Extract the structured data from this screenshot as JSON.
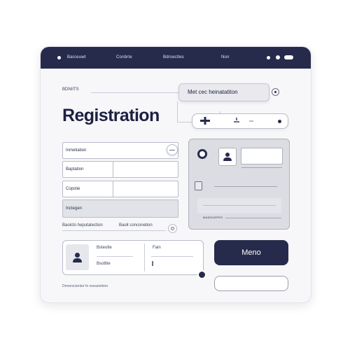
{
  "titlebar": {
    "menu": [
      "Barceuwt",
      "Conbrte",
      "Bdrsectles",
      "Non"
    ]
  },
  "header": {
    "eyebrow": "BDNIITS",
    "title": "Registration"
  },
  "form": {
    "fields": [
      {
        "label": "Inmetiation"
      },
      {
        "label": "Baptation"
      },
      {
        "label": "Copstie"
      },
      {
        "label": "Inctegen"
      }
    ],
    "footer_left": "Baoicto heputatection",
    "footer_right": "Baoit conconetion"
  },
  "right": {
    "pill_text": "Met cec heinatatiton",
    "panel_caption": "MANOUEPES"
  },
  "profile": {
    "label1": "Bsteolte",
    "label2": "Bsotltie",
    "value1": "Fain"
  },
  "menu_button": {
    "label": "Meno"
  },
  "bottom_note": "Drmersctontor fo eoeanettem",
  "colors": {
    "primary": "#262b4c",
    "background": "#f7f7f9",
    "panel": "#dcdde2"
  }
}
